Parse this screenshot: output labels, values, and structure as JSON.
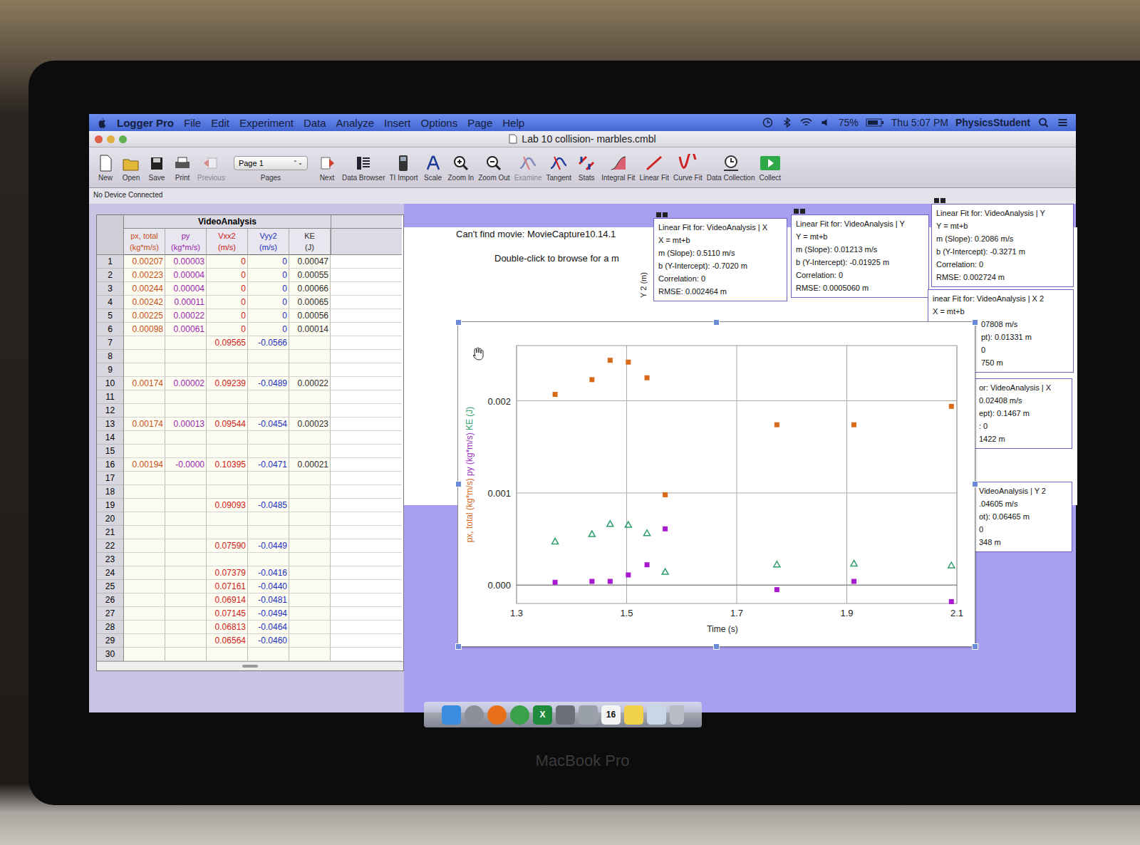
{
  "menubar": {
    "app": "Logger Pro",
    "menus": [
      "File",
      "Edit",
      "Experiment",
      "Data",
      "Analyze",
      "Insert",
      "Options",
      "Page",
      "Help"
    ],
    "battery": "75%",
    "clock": "Thu 5:07 PM",
    "user": "PhysicsStudent"
  },
  "window": {
    "title": "Lab 10 collision- marbles.cmbl",
    "status": "No Device Connected"
  },
  "toolbar": [
    {
      "label": "New",
      "kind": "doc",
      "disabled": false
    },
    {
      "label": "Open",
      "kind": "folder",
      "disabled": false
    },
    {
      "label": "Save",
      "kind": "disk",
      "disabled": false
    },
    {
      "label": "Print",
      "kind": "printer",
      "disabled": false
    },
    {
      "label": "Previous",
      "kind": "back",
      "disabled": true
    },
    {
      "label": "Pages",
      "kind": "select",
      "value": "Page 1",
      "disabled": false
    },
    {
      "label": "Next",
      "kind": "next",
      "disabled": false
    },
    {
      "label": "Data Browser",
      "kind": "browser",
      "disabled": false
    },
    {
      "label": "TI Import",
      "kind": "calc",
      "disabled": false
    },
    {
      "label": "Scale",
      "kind": "scale",
      "disabled": false
    },
    {
      "label": "Zoom In",
      "kind": "zoomin",
      "disabled": false
    },
    {
      "label": "Zoom Out",
      "kind": "zoomout",
      "disabled": false
    },
    {
      "label": "Examine",
      "kind": "curve",
      "disabled": true
    },
    {
      "label": "Tangent",
      "kind": "curve",
      "disabled": false
    },
    {
      "label": "Stats",
      "kind": "stats",
      "disabled": false
    },
    {
      "label": "Integral Fit",
      "kind": "integral",
      "disabled": false
    },
    {
      "label": "Linear Fit",
      "kind": "linear",
      "disabled": false
    },
    {
      "label": "Curve Fit",
      "kind": "curvefit",
      "disabled": false
    },
    {
      "label": "Data Collection",
      "kind": "clock",
      "disabled": false
    },
    {
      "label": "Collect",
      "kind": "collect",
      "disabled": false
    }
  ],
  "table": {
    "title": "VideoAnalysis",
    "columns": [
      {
        "name": "px, total",
        "unit": "(kg*m/s)",
        "color": "#c8501a"
      },
      {
        "name": "py",
        "unit": "(kg*m/s)",
        "color": "#9a1fb0"
      },
      {
        "name": "Vxx2",
        "unit": "(m/s)",
        "color": "#d02020"
      },
      {
        "name": "Vyy2",
        "unit": "(m/s)",
        "color": "#2030c0"
      },
      {
        "name": "KE",
        "unit": "(J)",
        "color": "#303030"
      }
    ],
    "rows": [
      {
        "n": "1",
        "cells": [
          "0.00207",
          "0.00003",
          "0",
          "0",
          "0.00047"
        ]
      },
      {
        "n": "2",
        "cells": [
          "0.00223",
          "0.00004",
          "0",
          "0",
          "0.00055"
        ]
      },
      {
        "n": "3",
        "cells": [
          "0.00244",
          "0.00004",
          "0",
          "0",
          "0.00066"
        ]
      },
      {
        "n": "4",
        "cells": [
          "0.00242",
          "0.00011",
          "0",
          "0",
          "0.00065"
        ]
      },
      {
        "n": "5",
        "cells": [
          "0.00225",
          "0.00022",
          "0",
          "0",
          "0.00056"
        ]
      },
      {
        "n": "6",
        "cells": [
          "0.00098",
          "0.00061",
          "0",
          "0",
          "0.00014"
        ]
      },
      {
        "n": "7",
        "cells": [
          "",
          "",
          "0.09565",
          "-0.0566",
          ""
        ]
      },
      {
        "n": "8",
        "cells": [
          "",
          "",
          "",
          "",
          ""
        ]
      },
      {
        "n": "9",
        "cells": [
          "",
          "",
          "",
          "",
          ""
        ]
      },
      {
        "n": "10",
        "cells": [
          "0.00174",
          "0.00002",
          "0.09239",
          "-0.0489",
          "0.00022"
        ]
      },
      {
        "n": "11",
        "cells": [
          "",
          "",
          "",
          "",
          ""
        ]
      },
      {
        "n": "12",
        "cells": [
          "",
          "",
          "",
          "",
          ""
        ]
      },
      {
        "n": "13",
        "cells": [
          "0.00174",
          "0.00013",
          "0.09544",
          "-0.0454",
          "0.00023"
        ]
      },
      {
        "n": "14",
        "cells": [
          "",
          "",
          "",
          "",
          ""
        ]
      },
      {
        "n": "15",
        "cells": [
          "",
          "",
          "",
          "",
          ""
        ]
      },
      {
        "n": "16",
        "cells": [
          "0.00194",
          "-0.0000",
          "0.10395",
          "-0.0471",
          "0.00021"
        ]
      },
      {
        "n": "17",
        "cells": [
          "",
          "",
          "",
          "",
          ""
        ]
      },
      {
        "n": "18",
        "cells": [
          "",
          "",
          "",
          "",
          ""
        ]
      },
      {
        "n": "19",
        "cells": [
          "",
          "",
          "0.09093",
          "-0.0485",
          ""
        ]
      },
      {
        "n": "20",
        "cells": [
          "",
          "",
          "",
          "",
          ""
        ]
      },
      {
        "n": "21",
        "cells": [
          "",
          "",
          "",
          "",
          ""
        ]
      },
      {
        "n": "22",
        "cells": [
          "",
          "",
          "0.07590",
          "-0.0449",
          ""
        ]
      },
      {
        "n": "23",
        "cells": [
          "",
          "",
          "",
          "",
          ""
        ]
      },
      {
        "n": "24",
        "cells": [
          "",
          "",
          "0.07379",
          "-0.0416",
          ""
        ]
      },
      {
        "n": "25",
        "cells": [
          "",
          "",
          "0.07161",
          "-0.0440",
          ""
        ]
      },
      {
        "n": "26",
        "cells": [
          "",
          "",
          "0.06914",
          "-0.0481",
          ""
        ]
      },
      {
        "n": "27",
        "cells": [
          "",
          "",
          "0.07145",
          "-0.0494",
          ""
        ]
      },
      {
        "n": "28",
        "cells": [
          "",
          "",
          "0.06813",
          "-0.0464",
          ""
        ]
      },
      {
        "n": "29",
        "cells": [
          "",
          "",
          "0.06564",
          "-0.0460",
          ""
        ]
      },
      {
        "n": "30",
        "cells": [
          "",
          "",
          "",
          "",
          ""
        ]
      }
    ]
  },
  "movie": {
    "line1": "Can't find movie: MovieCapture10.14.1",
    "line2": "Double-click to browse for a m"
  },
  "side_axis": "Y 2 (m)",
  "fits": [
    {
      "lines": [
        "Linear Fit for: VideoAnalysis | X",
        "X = mt+b",
        "m (Slope): 0.5110 m/s",
        "b (Y-Intercept): -0.7020 m",
        "Correlation: 0",
        "RMSE: 0.002464 m"
      ]
    },
    {
      "lines": [
        "Linear Fit for: VideoAnalysis | Y",
        "Y = mt+b",
        "m (Slope): 0.01213 m/s",
        "b (Y-Intercept): -0.01925 m",
        "Correlation: 0",
        "RMSE: 0.0005060 m"
      ]
    },
    {
      "lines": [
        "Linear Fit for: VideoAnalysis | Y",
        "Y = mt+b",
        "m (Slope): 0.2086 m/s",
        "b (Y-Intercept): -0.3271 m",
        "Correlation: 0",
        "RMSE: 0.002724 m"
      ]
    },
    {
      "lines": [
        "inear Fit for: VideoAnalysis | X 2",
        "X = mt+b",
        "07808 m/s",
        "pt): 0.01331 m",
        "0",
        "750 m"
      ]
    },
    {
      "lines": [
        "or: VideoAnalysis | X",
        "0.02408 m/s",
        "ept): 0.1467 m",
        ": 0",
        "1422 m"
      ]
    },
    {
      "lines": [
        "VideoAnalysis | Y 2",
        ".04605 m/s",
        "ot): 0.06465 m",
        "0",
        "348 m"
      ]
    }
  ],
  "graph": {
    "y_labels": [
      {
        "text": "px, total (kg*m/s)",
        "color": "#d2691e"
      },
      {
        "text": "py (kg*m/s)",
        "color": "#9b30c0"
      },
      {
        "text": "KE (J)",
        "color": "#2e9e6a"
      }
    ],
    "x_label": "Time (s)",
    "x_ticks": [
      "1.3",
      "1.5",
      "1.7",
      "1.9",
      "2.1"
    ],
    "y_ticks": [
      "0.000",
      "0.001",
      "0.002"
    ],
    "series": [
      {
        "kind": "square",
        "color": "#d86a1a",
        "time": [
          1.37,
          1.437,
          1.47,
          1.503,
          1.537,
          1.57,
          1.773,
          1.913,
          2.09
        ],
        "values": [
          0.00207,
          0.00223,
          0.00244,
          0.00242,
          0.00225,
          0.00098,
          0.00174,
          0.00174,
          0.00194
        ]
      },
      {
        "kind": "square",
        "color": "#a81ad0",
        "time": [
          1.37,
          1.437,
          1.47,
          1.503,
          1.537,
          1.57,
          1.773,
          1.913,
          2.09
        ],
        "values": [
          3e-05,
          4e-05,
          4e-05,
          0.00011,
          0.00022,
          0.00061,
          -5e-05,
          4e-05,
          -0.00018
        ]
      },
      {
        "kind": "triangle",
        "color": "#2e9e6a",
        "time": [
          1.37,
          1.437,
          1.47,
          1.503,
          1.537,
          1.57,
          1.773,
          1.913,
          2.09
        ],
        "values": [
          0.00047,
          0.00055,
          0.00066,
          0.00065,
          0.00056,
          0.00014,
          0.00022,
          0.00023,
          0.00021
        ]
      }
    ]
  },
  "dock": [
    {
      "kind": "finder",
      "color": "#3b8de0",
      "label": ""
    },
    {
      "kind": "round",
      "color": "#8a8f99",
      "label": ""
    },
    {
      "kind": "round",
      "color": "#e8701a",
      "label": ""
    },
    {
      "kind": "round",
      "color": "#3aa04a",
      "label": ""
    },
    {
      "kind": "square",
      "color": "#1f8a3c",
      "label": "X"
    },
    {
      "kind": "square",
      "color": "#6a6f78",
      "label": ""
    },
    {
      "kind": "square",
      "color": "#9aa0aa",
      "label": ""
    },
    {
      "kind": "square",
      "color": "#f4f4f4",
      "label": "16"
    },
    {
      "kind": "square",
      "color": "#f2d24a",
      "label": ""
    },
    {
      "kind": "square",
      "color": "#c9d6e6",
      "label": ""
    },
    {
      "kind": "trash",
      "color": "#b8bcc4",
      "label": ""
    }
  ],
  "bezel": {
    "label": "MacBook Pro"
  }
}
